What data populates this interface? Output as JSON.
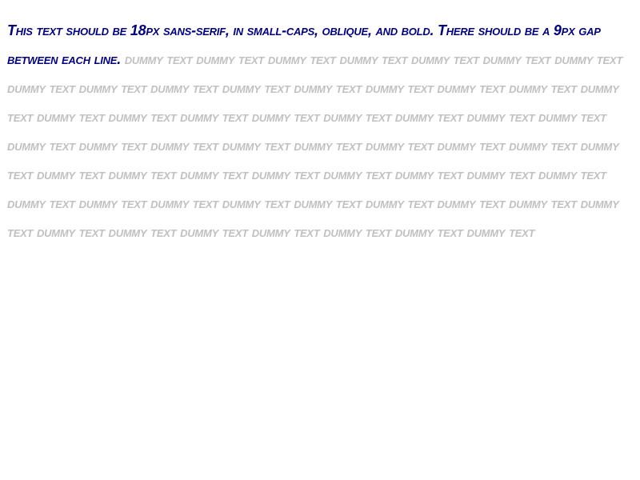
{
  "document": {
    "instruction_text": "This text should be 18px sans-serif, in small-caps, oblique, and bold. There should be a 9px gap between each line.",
    "filler_text": "dummy text dummy text dummy text dummy text dummy text dummy text dummy text dummy text dummy text dummy text dummy text dummy text dummy text dummy text dummy text dummy text dummy text dummy text dummy text dummy text dummy text dummy text dummy text dummy text dummy text dummy text dummy text dummy text dummy text dummy text dummy text dummy text dummy text dummy text dummy text dummy text dummy text dummy text dummy text dummy text dummy text dummy text dummy text dummy text dummy text dummy text dummy text dummy text dummy text dummy text dummy text dummy text dummy text dummy text dummy text dummy text dummy text",
    "colors": {
      "instruction": "#000080",
      "filler": "#c0c0c0",
      "background": "#ffffff"
    }
  }
}
